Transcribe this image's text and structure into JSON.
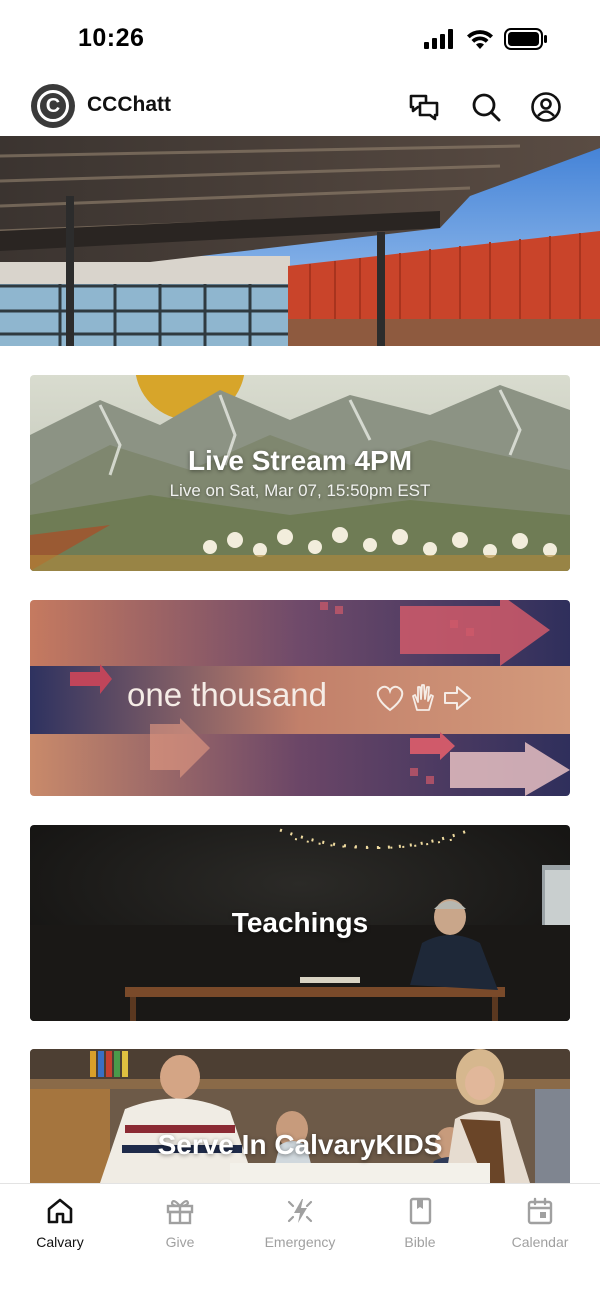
{
  "status_bar": {
    "time": "10:26"
  },
  "header": {
    "logo_letter": "C",
    "app_name": "CCChatt",
    "icons": [
      "chat-bubbles-icon",
      "search-icon",
      "account-icon"
    ]
  },
  "cards": [
    {
      "title": "Live Stream 4PM",
      "subtitle": "Live on Sat, Mar 07, 15:50pm EST"
    },
    {
      "title": "one thousand"
    },
    {
      "title": "Teachings"
    },
    {
      "title": "Serve In CalvaryKIDS"
    }
  ],
  "tabs": [
    {
      "label": "Calvary",
      "icon": "home-icon",
      "active": true
    },
    {
      "label": "Give",
      "icon": "gift-icon",
      "active": false
    },
    {
      "label": "Emergency",
      "icon": "emergency-icon",
      "active": false
    },
    {
      "label": "Bible",
      "icon": "bible-icon",
      "active": false
    },
    {
      "label": "Calendar",
      "icon": "calendar-icon",
      "active": false
    }
  ],
  "colors": {
    "active_tab": "#111111",
    "inactive_tab": "#a0a0a0"
  }
}
